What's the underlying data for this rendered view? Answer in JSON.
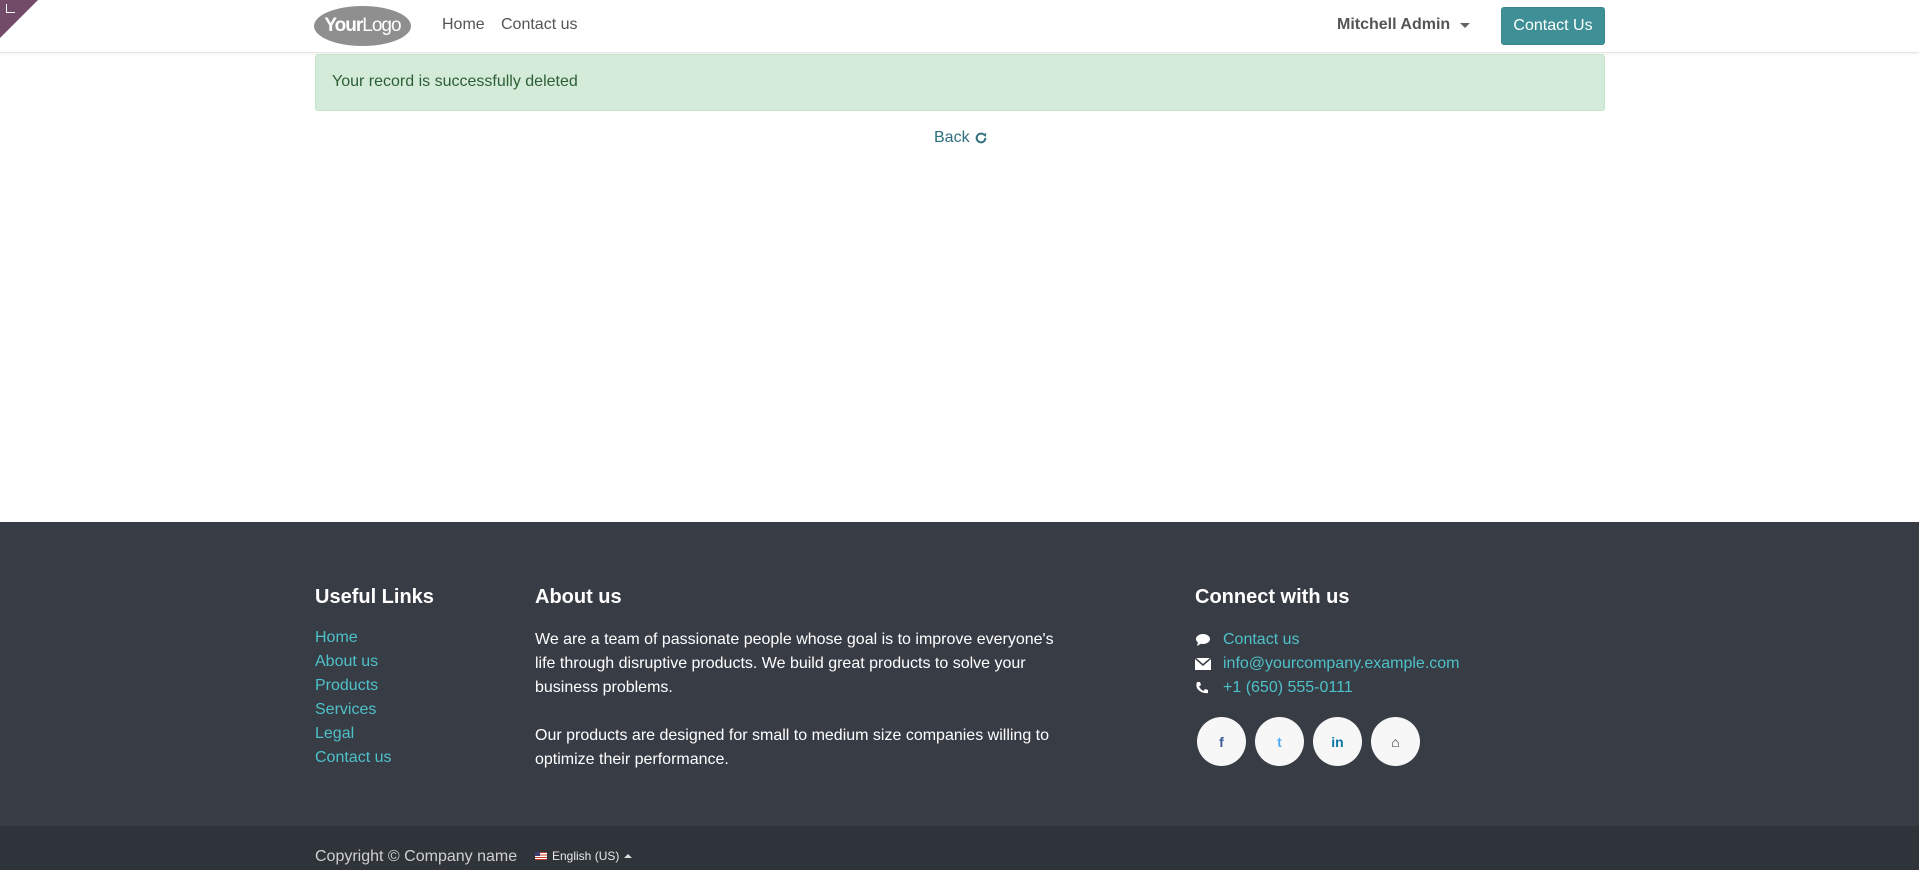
{
  "colors": {
    "corner": "#714b67",
    "cta_button": "#3e8f96",
    "alert_bg": "#d4ebd9",
    "alert_text": "#2d5e36",
    "footer_bg": "#373c45",
    "footer_link": "#4fc1c8",
    "bottom_bar_bg": "#2f333a"
  },
  "header": {
    "logo": {
      "part1": "Your",
      "part2": "Logo"
    },
    "nav": [
      {
        "label": "Home"
      },
      {
        "label": "Contact us"
      }
    ],
    "user_menu": "Mitchell Admin",
    "cta_label": "Contact Us"
  },
  "main": {
    "alert_text": "Your record is successfully deleted",
    "back_label": "Back"
  },
  "footer": {
    "useful_links": {
      "title": "Useful Links",
      "items": [
        "Home",
        "About us",
        "Products",
        "Services",
        "Legal",
        "Contact us"
      ]
    },
    "about": {
      "title": "About us",
      "paragraphs": [
        "We are a team of passionate people whose goal is to improve everyone's life through disruptive products. We build great products to solve your business problems.",
        "Our products are designed for small to medium size companies willing to optimize their performance."
      ]
    },
    "connect": {
      "title": "Connect with us",
      "items": [
        {
          "icon": "comment-icon",
          "label": "Contact us"
        },
        {
          "icon": "envelope-icon",
          "label": "info@yourcompany.example.com"
        },
        {
          "icon": "phone-icon",
          "label": "+1 (650) 555-0111"
        }
      ],
      "socials": [
        {
          "icon": "facebook-icon",
          "glyph": "f"
        },
        {
          "icon": "twitter-icon",
          "glyph": "t"
        },
        {
          "icon": "linkedin-icon",
          "glyph": "in"
        },
        {
          "icon": "home-icon",
          "glyph": "⌂"
        }
      ]
    }
  },
  "bottom_bar": {
    "copyright": "Copyright © Company name",
    "language": "English (US)"
  }
}
